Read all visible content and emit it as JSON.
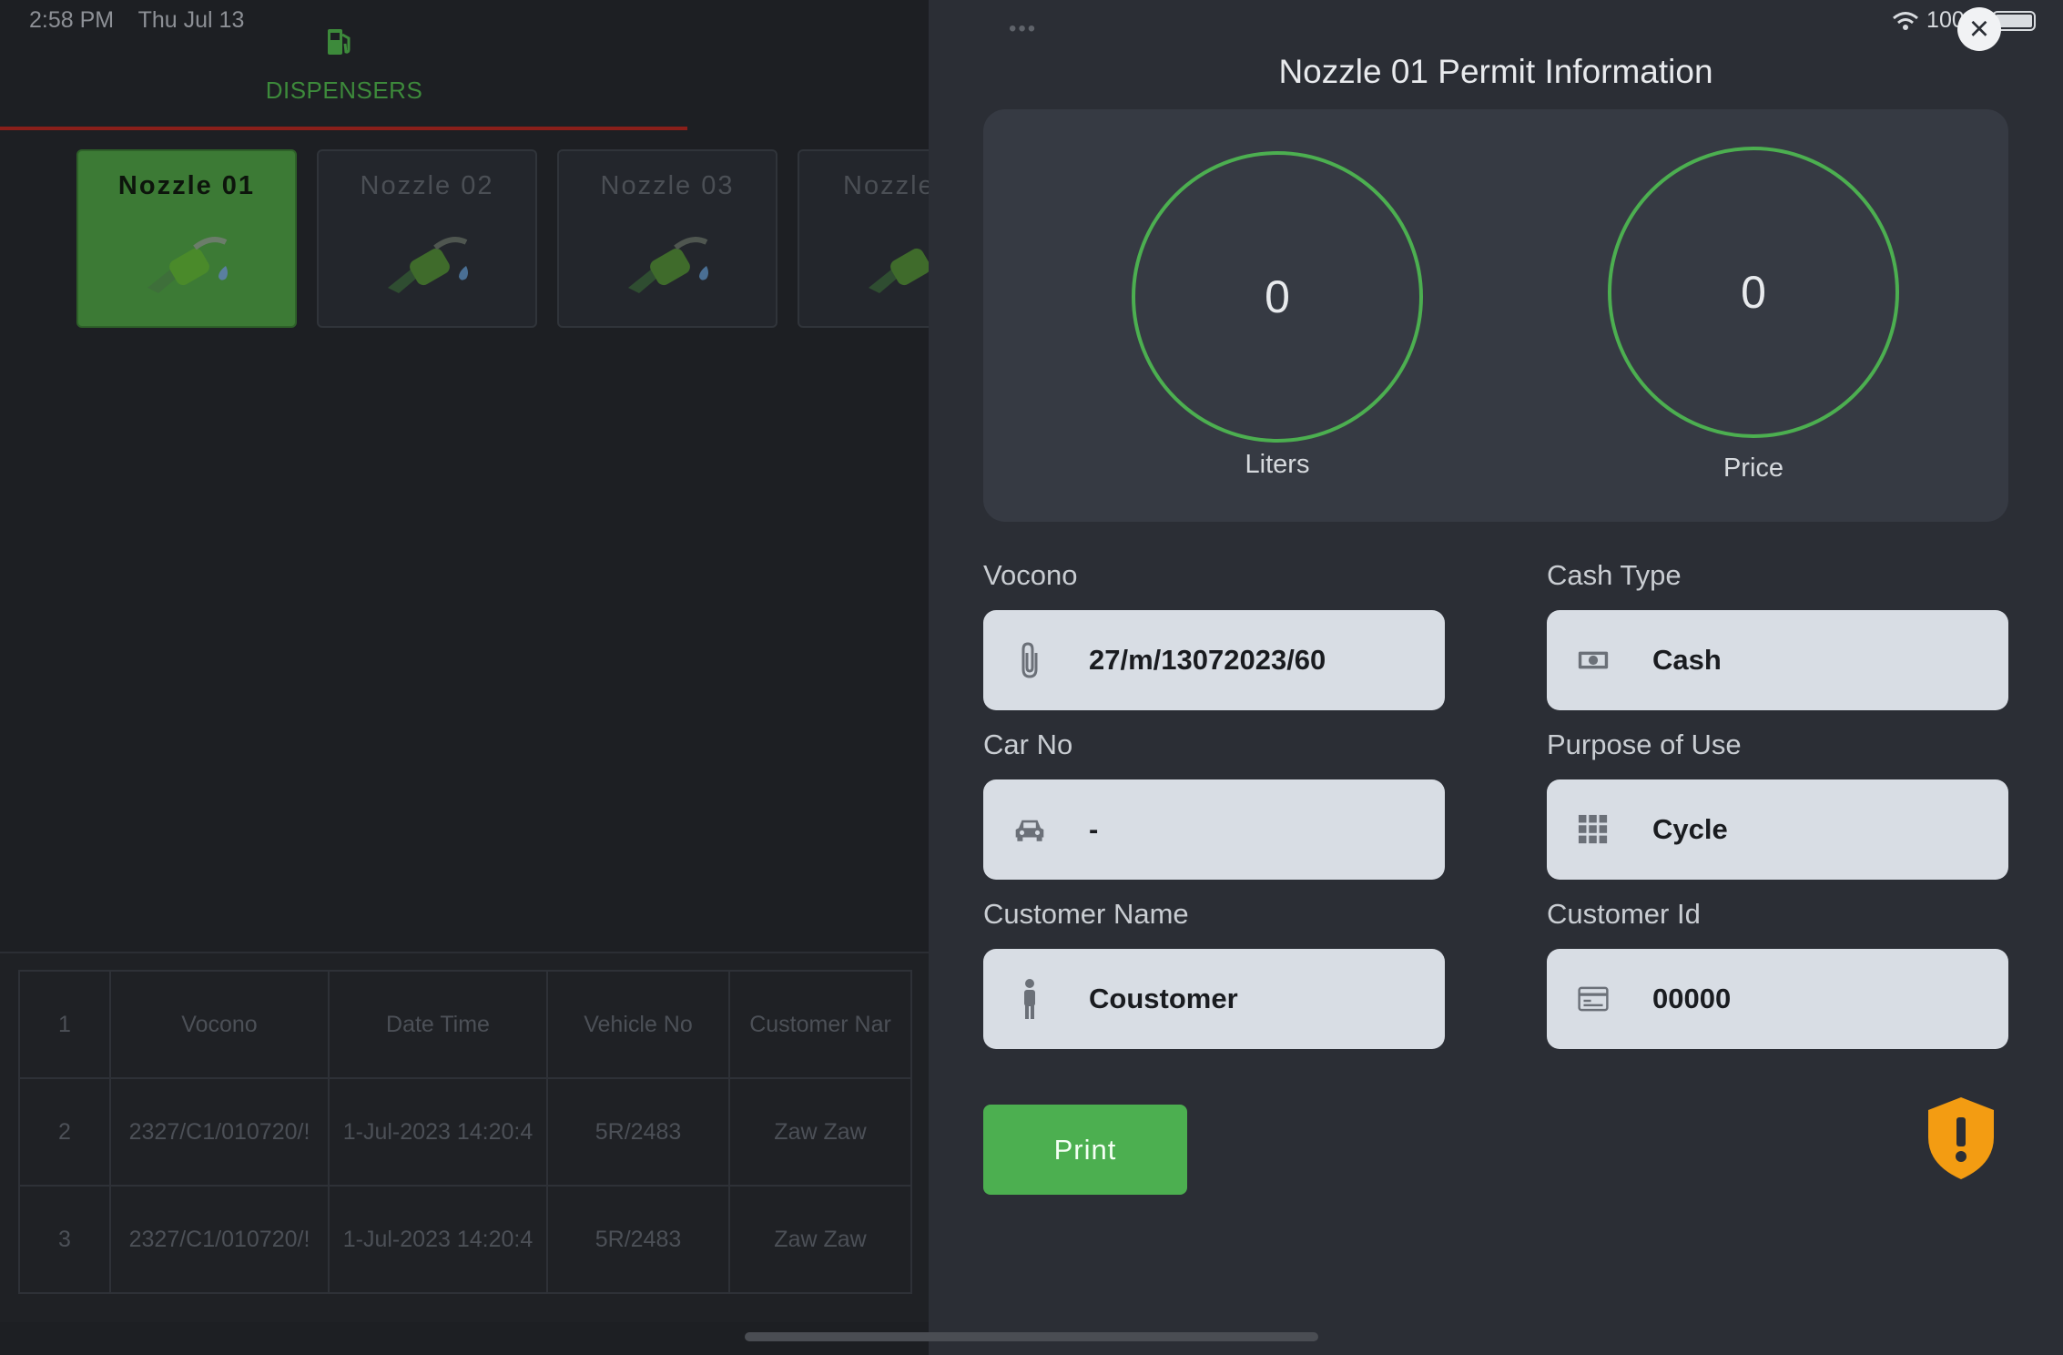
{
  "status_bar": {
    "time": "2:58 PM",
    "date": "Thu Jul 13",
    "battery": "100%"
  },
  "background_app": {
    "tab_label": "DISPENSERS",
    "nozzles": [
      {
        "label": "Nozzle 01",
        "active": true
      },
      {
        "label": "Nozzle 02",
        "active": false
      },
      {
        "label": "Nozzle 03",
        "active": false
      },
      {
        "label": "Nozzle",
        "active": false
      }
    ],
    "table": {
      "rows": [
        [
          "1",
          "Vocono",
          "Date Time",
          "Vehicle No",
          "Customer Nar"
        ],
        [
          "2",
          "2327/C1/010720/!",
          "1-Jul-2023 14:20:4",
          "5R/2483",
          "Zaw Zaw"
        ],
        [
          "3",
          "2327/C1/010720/!",
          "1-Jul-2023 14:20:4",
          "5R/2483",
          "Zaw Zaw"
        ]
      ]
    }
  },
  "modal": {
    "title": "Nozzle 01 Permit Information",
    "close_icon": "close-icon",
    "gauges": {
      "liters": {
        "value": "0",
        "label": "Liters"
      },
      "price": {
        "value": "0",
        "label": "Price"
      }
    },
    "fields": {
      "vocono": {
        "label": "Vocono",
        "value": "27/m/13072023/60",
        "icon": "paperclip-icon"
      },
      "cash_type": {
        "label": "Cash Type",
        "value": "Cash",
        "icon": "banknote-icon"
      },
      "car_no": {
        "label": "Car No",
        "value": "-",
        "icon": "car-icon"
      },
      "purpose": {
        "label": "Purpose of Use",
        "value": "Cycle",
        "icon": "grid-icon"
      },
      "customer_name": {
        "label": "Customer Name",
        "value": "Coustomer",
        "icon": "person-icon"
      },
      "customer_id": {
        "label": "Customer Id",
        "value": "00000",
        "icon": "id-card-icon"
      }
    },
    "print_label": "Print",
    "warning_icon": "shield-warning-icon"
  },
  "colors": {
    "accent_green": "#4caf50",
    "warning_orange": "#f39c12",
    "tab_underline": "#8a1f1a"
  }
}
